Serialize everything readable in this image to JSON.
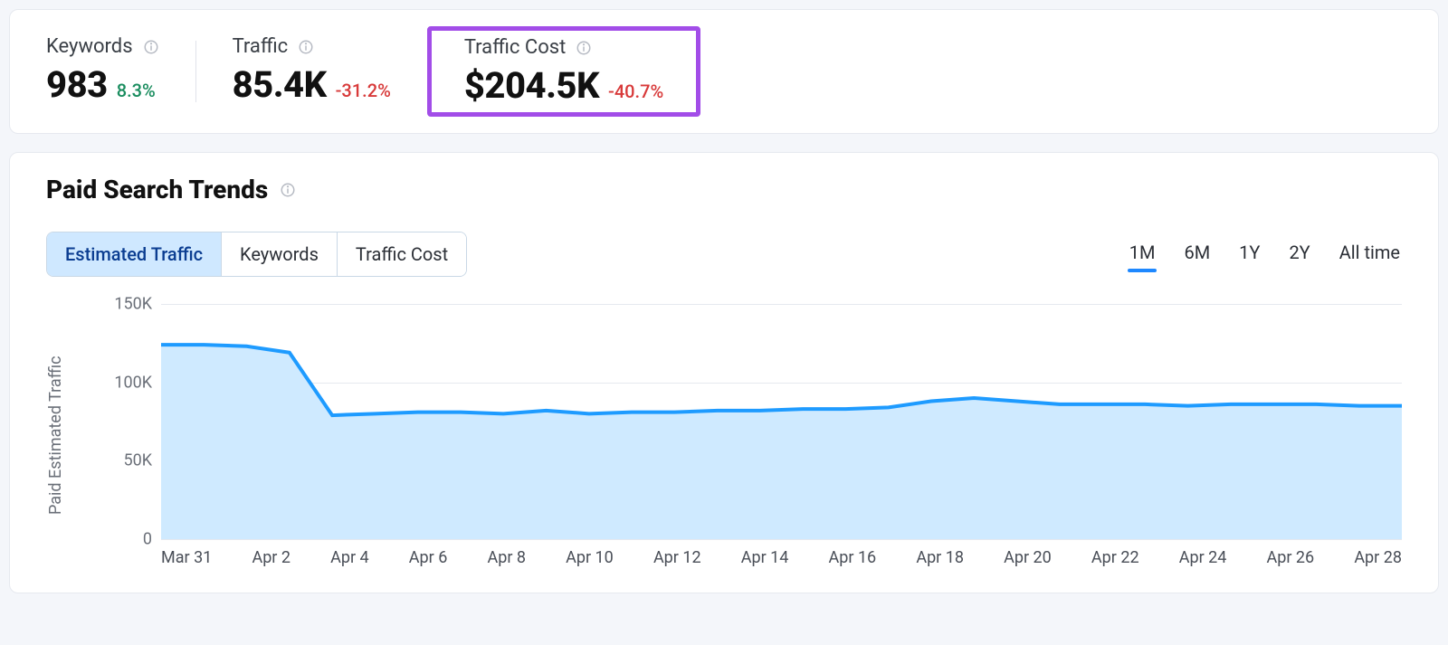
{
  "kpis": [
    {
      "label": "Keywords",
      "value": "983",
      "delta": "8.3%",
      "delta_dir": "pos",
      "highlight": false
    },
    {
      "label": "Traffic",
      "value": "85.4K",
      "delta": "-31.2%",
      "delta_dir": "neg",
      "highlight": false
    },
    {
      "label": "Traffic Cost",
      "value": "$204.5K",
      "delta": "-40.7%",
      "delta_dir": "neg",
      "highlight": true
    }
  ],
  "trends": {
    "title": "Paid Search Trends",
    "metric_tabs": [
      "Estimated Traffic",
      "Keywords",
      "Traffic Cost"
    ],
    "metric_tab_active": 0,
    "ranges": [
      "1M",
      "6M",
      "1Y",
      "2Y",
      "All time"
    ],
    "range_active": 0,
    "y_axis_title": "Paid Estimated Traffic"
  },
  "colors": {
    "line": "#1e9bff",
    "area": "#cfeaff",
    "highlight": "#a24de8"
  },
  "chart_data": {
    "type": "area",
    "title": "Paid Search Trends — Estimated Traffic (1M)",
    "xlabel": "",
    "ylabel": "Paid Estimated Traffic",
    "ylim": [
      0,
      150000
    ],
    "yticks": [
      0,
      50000,
      100000,
      150000
    ],
    "ytick_labels": [
      "0",
      "50K",
      "100K",
      "150K"
    ],
    "x": [
      "Mar 30",
      "Mar 31",
      "Apr 1",
      "Apr 2",
      "Apr 3",
      "Apr 4",
      "Apr 5",
      "Apr 6",
      "Apr 7",
      "Apr 8",
      "Apr 9",
      "Apr 10",
      "Apr 11",
      "Apr 12",
      "Apr 13",
      "Apr 14",
      "Apr 15",
      "Apr 16",
      "Apr 17",
      "Apr 18",
      "Apr 19",
      "Apr 20",
      "Apr 21",
      "Apr 22",
      "Apr 23",
      "Apr 24",
      "Apr 25",
      "Apr 26",
      "Apr 27",
      "Apr 28"
    ],
    "xtick_labels": [
      "Mar 31",
      "Apr 2",
      "Apr 4",
      "Apr 6",
      "Apr 8",
      "Apr 10",
      "Apr 12",
      "Apr 14",
      "Apr 16",
      "Apr 18",
      "Apr 20",
      "Apr 22",
      "Apr 24",
      "Apr 26",
      "Apr 28"
    ],
    "values": [
      124000,
      124000,
      123000,
      119000,
      79000,
      80000,
      81000,
      81000,
      80000,
      82000,
      80000,
      81000,
      81000,
      82000,
      82000,
      83000,
      83000,
      84000,
      88000,
      90000,
      88000,
      86000,
      86000,
      86000,
      85000,
      86000,
      86000,
      86000,
      85000,
      85000
    ]
  }
}
